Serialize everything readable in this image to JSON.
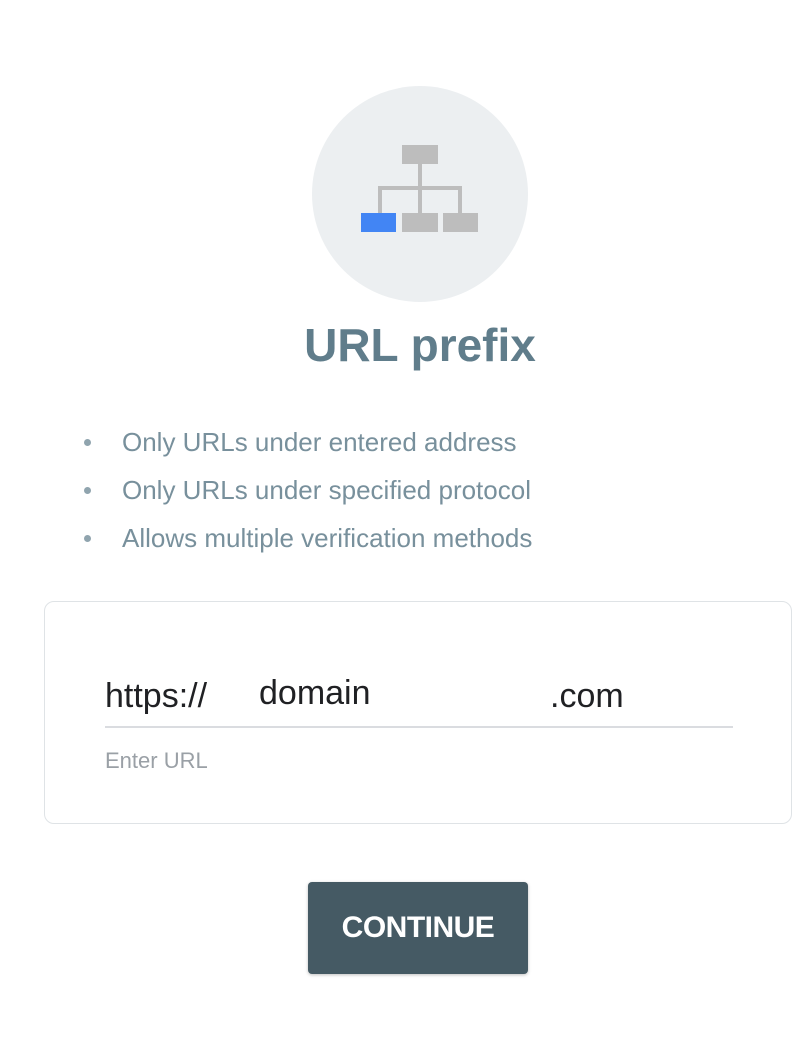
{
  "header": {
    "icon": "sitemap-icon",
    "title": "URL prefix"
  },
  "features": [
    "Only URLs under entered address",
    "Only URLs under specified protocol",
    "Allows multiple verification methods"
  ],
  "url_form": {
    "prefix": "https://",
    "value": "domain",
    "suffix": ".com",
    "helper_text": "Enter URL"
  },
  "actions": {
    "continue_label": "CONTINUE"
  },
  "colors": {
    "circle_background": "#eceff1",
    "title": "#607d8b",
    "feature_text": "#78909c",
    "icon_highlight": "#4285f4",
    "icon_gray": "#bdbdbd",
    "button_background": "#455a64"
  }
}
